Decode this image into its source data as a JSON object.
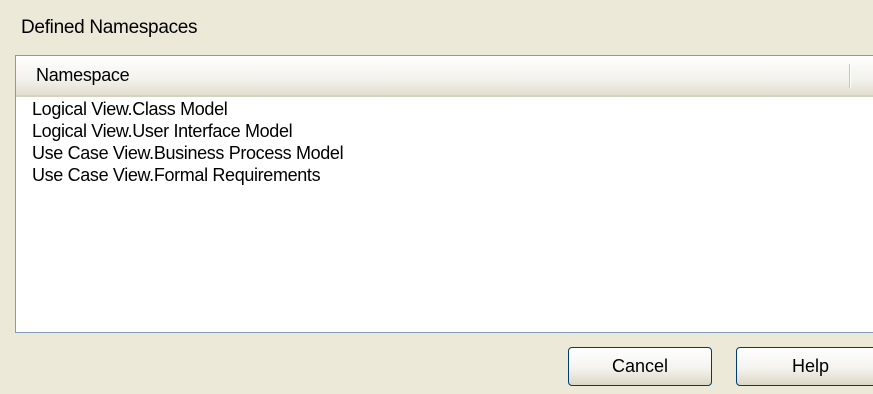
{
  "group": {
    "label": "Defined Namespaces"
  },
  "list": {
    "columns": [
      "Namespace"
    ],
    "rows": [
      "Logical View.Class Model",
      "Logical View.User Interface Model",
      "Use Case View.Business Process Model",
      "Use Case View.Formal Requirements"
    ]
  },
  "buttons": {
    "cancel": "Cancel",
    "help": "Help"
  }
}
